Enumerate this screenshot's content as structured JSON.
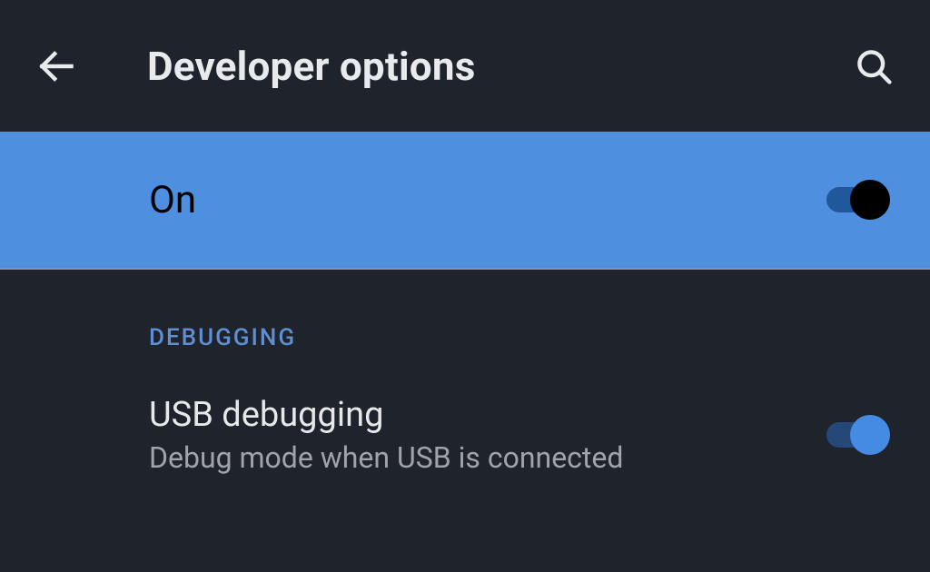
{
  "header": {
    "title": "Developer options"
  },
  "master_toggle": {
    "label": "On",
    "on": true
  },
  "section": {
    "label": "DEBUGGING"
  },
  "usb_debugging": {
    "title": "USB debugging",
    "subtitle": "Debug mode when USB is connected",
    "on": true
  }
}
